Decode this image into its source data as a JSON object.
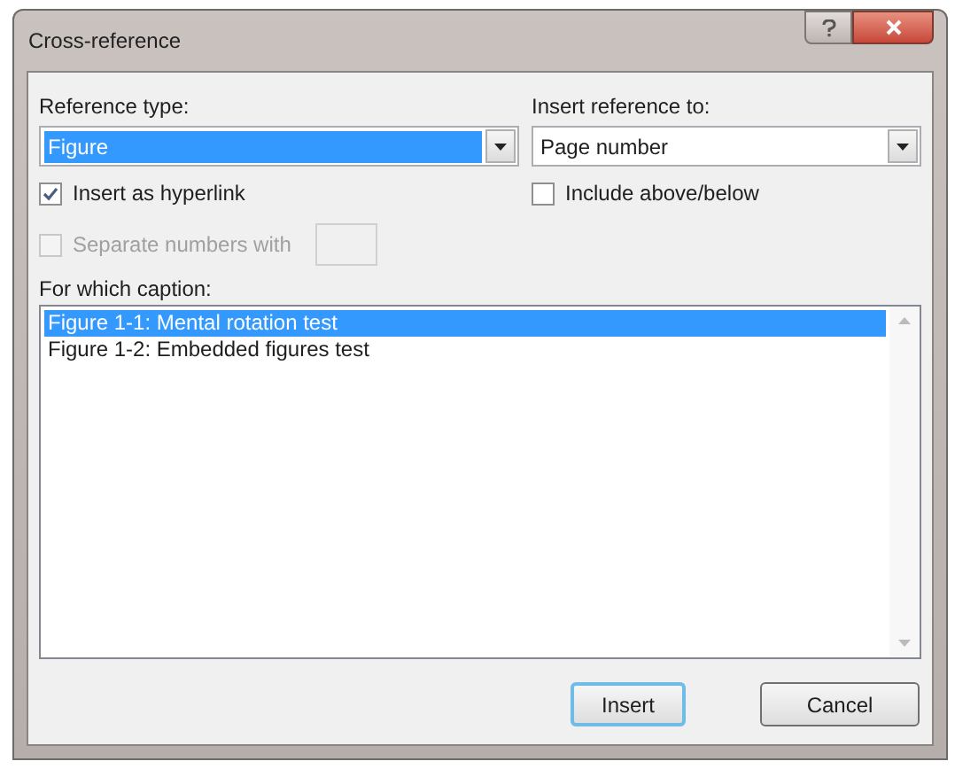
{
  "window": {
    "title": "Cross-reference"
  },
  "reference_type": {
    "label": "Reference type:",
    "value": "Figure"
  },
  "insert_as_hyperlink": {
    "label": "Insert as hyperlink",
    "checked": true,
    "disabled": false
  },
  "separate_numbers": {
    "label": "Separate numbers with",
    "checked": false,
    "disabled": true
  },
  "insert_reference_to": {
    "label": "Insert reference to:",
    "value": "Page number"
  },
  "include_above_below": {
    "label": "Include above/below",
    "checked": false,
    "disabled": false
  },
  "caption_list": {
    "label": "For which caption:",
    "items": [
      {
        "text": "Figure 1-1: Mental rotation test",
        "selected": true
      },
      {
        "text": "Figure 1-2: Embedded figures test",
        "selected": false
      }
    ]
  },
  "buttons": [
    {
      "label": "Insert",
      "default": true
    },
    {
      "label": "Cancel",
      "default": false
    }
  ]
}
